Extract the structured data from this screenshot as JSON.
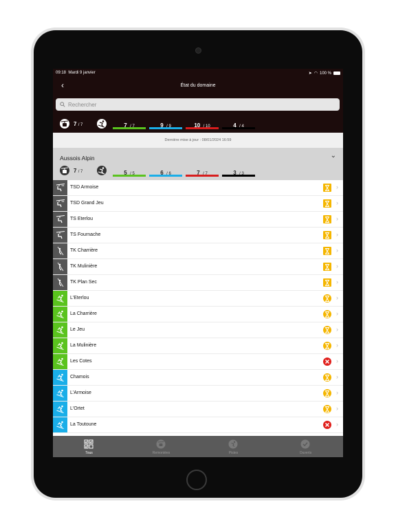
{
  "status_bar": {
    "time": "09:18",
    "date": "Mardi 9 janvier",
    "battery": "100 %"
  },
  "nav": {
    "title": "État du domaine",
    "back_icon": "chevron-left-icon"
  },
  "search": {
    "placeholder": "Rechercher"
  },
  "summary": {
    "lifts_open": "7",
    "lifts_total": "/ 7",
    "pistes": [
      {
        "open": "7",
        "total": "/ 7",
        "color": "#5ac31e"
      },
      {
        "open": "9",
        "total": "/ 9",
        "color": "#1aaee8"
      },
      {
        "open": "10",
        "total": "/ 10",
        "color": "#d71c1c"
      },
      {
        "open": "4",
        "total": "/ 4",
        "color": "#000000"
      }
    ]
  },
  "last_update": "Dernière mise à jour : 08/01/2024 16:59",
  "resort": {
    "name": "Aussois Alpin",
    "lifts_open": "7",
    "lifts_total": "/ 7",
    "pistes": [
      {
        "open": "5",
        "total": "/ 5",
        "color": "#5ac31e"
      },
      {
        "open": "6",
        "total": "/ 6",
        "color": "#1aaee8"
      },
      {
        "open": "7",
        "total": "/ 7",
        "color": "#d71c1c"
      },
      {
        "open": "3",
        "total": "/ 3",
        "color": "#000000"
      }
    ]
  },
  "items": [
    {
      "name": "TSD Armoise",
      "kind": "lift",
      "lift_icon": "detachable-chairlift-icon",
      "status": "waiting-square"
    },
    {
      "name": "TSD Grand Jeu",
      "kind": "lift",
      "lift_icon": "detachable-chairlift-icon",
      "status": "waiting-square"
    },
    {
      "name": "TS Eterlou",
      "kind": "lift",
      "lift_icon": "chairlift-icon",
      "status": "waiting-square"
    },
    {
      "name": "TS Fournache",
      "kind": "lift",
      "lift_icon": "chairlift-icon",
      "status": "waiting-square"
    },
    {
      "name": "TK Charrière",
      "kind": "lift",
      "lift_icon": "surface-lift-icon",
      "status": "waiting-square"
    },
    {
      "name": "TK Mulinière",
      "kind": "lift",
      "lift_icon": "surface-lift-icon",
      "status": "waiting-square"
    },
    {
      "name": "TK Plan Sec",
      "kind": "lift",
      "lift_icon": "surface-lift-icon",
      "status": "waiting-square"
    },
    {
      "name": "L'Eterlou",
      "kind": "green",
      "status": "waiting-circle"
    },
    {
      "name": "La Charrière",
      "kind": "green",
      "status": "waiting-circle"
    },
    {
      "name": "Le Jeu",
      "kind": "green",
      "status": "waiting-circle"
    },
    {
      "name": "La Mulinière",
      "kind": "green",
      "status": "waiting-circle"
    },
    {
      "name": "Les Cotes",
      "kind": "green",
      "status": "closed"
    },
    {
      "name": "Chamois",
      "kind": "blue",
      "status": "waiting-circle"
    },
    {
      "name": "L'Armoise",
      "kind": "blue",
      "status": "waiting-circle"
    },
    {
      "name": "L'Ortet",
      "kind": "blue",
      "status": "waiting-circle"
    },
    {
      "name": "La Toutoune",
      "kind": "blue",
      "status": "closed"
    }
  ],
  "tabs": [
    {
      "label": "Tous",
      "icon": "checklist-icon",
      "active": true
    },
    {
      "label": "Remontées",
      "icon": "lift-icon",
      "active": false
    },
    {
      "label": "Pistes",
      "icon": "skier-icon",
      "active": false
    },
    {
      "label": "Ouverts",
      "icon": "check-circle-icon",
      "active": false
    }
  ],
  "colors": {
    "header_bg": "#1c0c0c",
    "lift_icon_bg": "#555555",
    "green": "#5ac31e",
    "blue": "#1aaee8",
    "red": "#d71c1c",
    "status_waiting": "#f5b600",
    "status_closed": "#e0201c",
    "tabbar_bg": "#5a5a5a"
  }
}
